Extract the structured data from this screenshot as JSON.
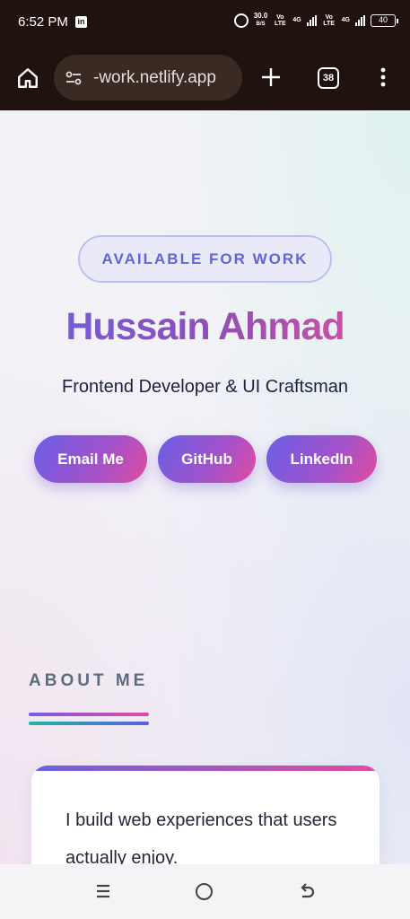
{
  "status_bar": {
    "time": "6:52 PM",
    "app_icon": "linkedin-icon",
    "alarm_icon": "alarm-icon",
    "net_speed_value": "30.0",
    "net_speed_unit": "B/S",
    "volte1": "Vo LTE",
    "net1": "4G",
    "volte2": "Vo LTE",
    "net2": "4G",
    "battery": "40"
  },
  "browser": {
    "url": "-work.netlify.app",
    "tab_count": "38",
    "home_icon": "home-icon",
    "site_settings_icon": "site-settings-icon",
    "new_tab_icon": "plus-icon",
    "menu_icon": "more-vert-icon"
  },
  "hero": {
    "badge": "AVAILABLE FOR WORK",
    "name": "Hussain Ahmad",
    "subtitle": "Frontend Developer & UI Craftsman",
    "buttons": [
      "Email Me",
      "GitHub",
      "LinkedIn"
    ]
  },
  "about": {
    "title": "ABOUT ME",
    "text": "I build web experiences that users actually enjoy."
  },
  "colors": {
    "accent_start": "#6a62e0",
    "accent_end": "#e04c9e",
    "teal": "#20b6a2",
    "toolbar_bg": "#1f120f"
  }
}
